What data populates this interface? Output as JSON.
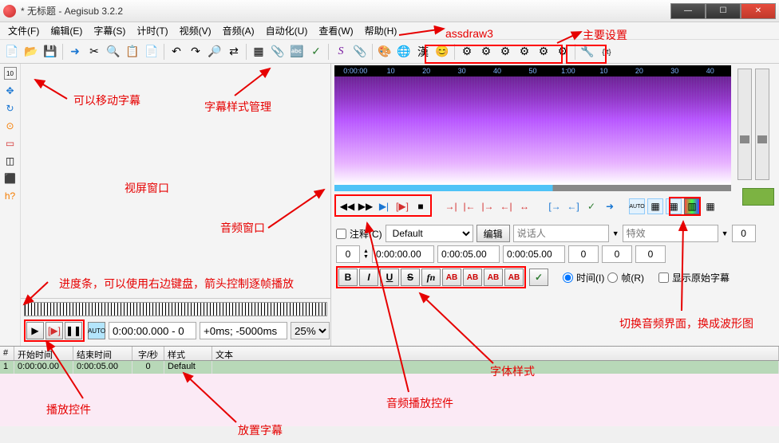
{
  "window": {
    "title": "* 无标题 - Aegisub 3.2.2"
  },
  "menu": {
    "file": "文件(F)",
    "edit": "编辑(E)",
    "subtitle": "字幕(S)",
    "timing": "计时(T)",
    "video": "视频(V)",
    "audio": "音频(A)",
    "automation": "自动化(U)",
    "view": "查看(W)",
    "help": "帮助(H)"
  },
  "toolbar_icons": {
    "new": "📄",
    "open": "📂",
    "save": "💾",
    "fwd": "➜",
    "cut": "✂",
    "find": "🔍",
    "copy": "📋",
    "paste": "📄",
    "undo": "↶",
    "redo": "↷",
    "zoom": "🔎",
    "shift": "⇄",
    "style": "▦",
    "attach": "📎",
    "font": "🔤",
    "spell": "✓",
    "assdraw": "S",
    "clip": "📎",
    "color": "🎨",
    "trans": "🌐",
    "kanji": "漢",
    "face": "😊",
    "cfg1": "⚙",
    "cfg2": "⚙",
    "cfg3": "⚙",
    "opt": "⚙",
    "opt2": "⚙",
    "opt3": "⚙",
    "tool": "🔧",
    "tag": "{\\t}"
  },
  "left_tools": {
    "move": "⬚",
    "arrow": "✥",
    "rotz": "↻",
    "rotxy": "⊙",
    "scale": "▭",
    "clip": "◫",
    "vclip": "⬛",
    "h": "h?"
  },
  "spec_ruler": [
    "0:00:00",
    "10",
    "20",
    "30",
    "40",
    "50",
    "1:00",
    "10",
    "20",
    "30",
    "40"
  ],
  "audio_btns": {
    "prev": "◀◀",
    "next": "▶▶",
    "play": "▶|",
    "playsel": "[▶]",
    "stop": "■",
    "b1": "→|",
    "b2": "|←",
    "b3": "|→",
    "b4": "←|",
    "b5": "↔",
    "a1": "[→",
    "a2": "←]",
    "chk": "✓",
    "go": "➜",
    "auto": "AUTO",
    "s1": "▦",
    "s2": "▦",
    "spec": "▥",
    "s4": "▦"
  },
  "edit": {
    "comment_label": "注释(C)",
    "style_default": "Default",
    "edit_btn": "编辑",
    "actor_ph": "说话人",
    "effect_ph": "特效",
    "layer": "0",
    "r2_a": "0",
    "start": "0:00:00.00",
    "end": "0:00:05.00",
    "dur": "0:00:05.00",
    "m1": "0",
    "m2": "0",
    "m3": "0",
    "time_label": "时间(I)",
    "frame_label": "帧(R)",
    "orig_label": "显示原始字幕",
    "ab1": "AB",
    "ab2": "AB",
    "ab3": "AB",
    "ab4": "AB"
  },
  "video": {
    "pos": "0:00:00.000 - 0",
    "delay": "+0ms; -5000ms",
    "zoom": "25%"
  },
  "grid": {
    "h_num": "#",
    "h_start": "开始时间",
    "h_end": "结束时间",
    "h_cps": "字/秒",
    "h_style": "样式",
    "h_text": "文本",
    "r_num": "1",
    "r_start": "0:00:00.00",
    "r_end": "0:00:05.00",
    "r_cps": "0",
    "r_style": "Default",
    "r_text": ""
  },
  "ann": {
    "assdraw": "assdraw3",
    "main_set": "主要设置",
    "move_sub": "可以移动字幕",
    "style_mgr": "字幕样式管理",
    "video_win": "视屏窗口",
    "audio_win": "音频窗口",
    "progress": "进度条，可以使用右边键盘，箭头控制逐帧播放",
    "play_ctrl": "播放控件",
    "place_sub": "放置字幕",
    "audio_play": "音频播放控件",
    "font_style": "字体样式",
    "switch_audio": "切换音频界面，换成波形图"
  }
}
